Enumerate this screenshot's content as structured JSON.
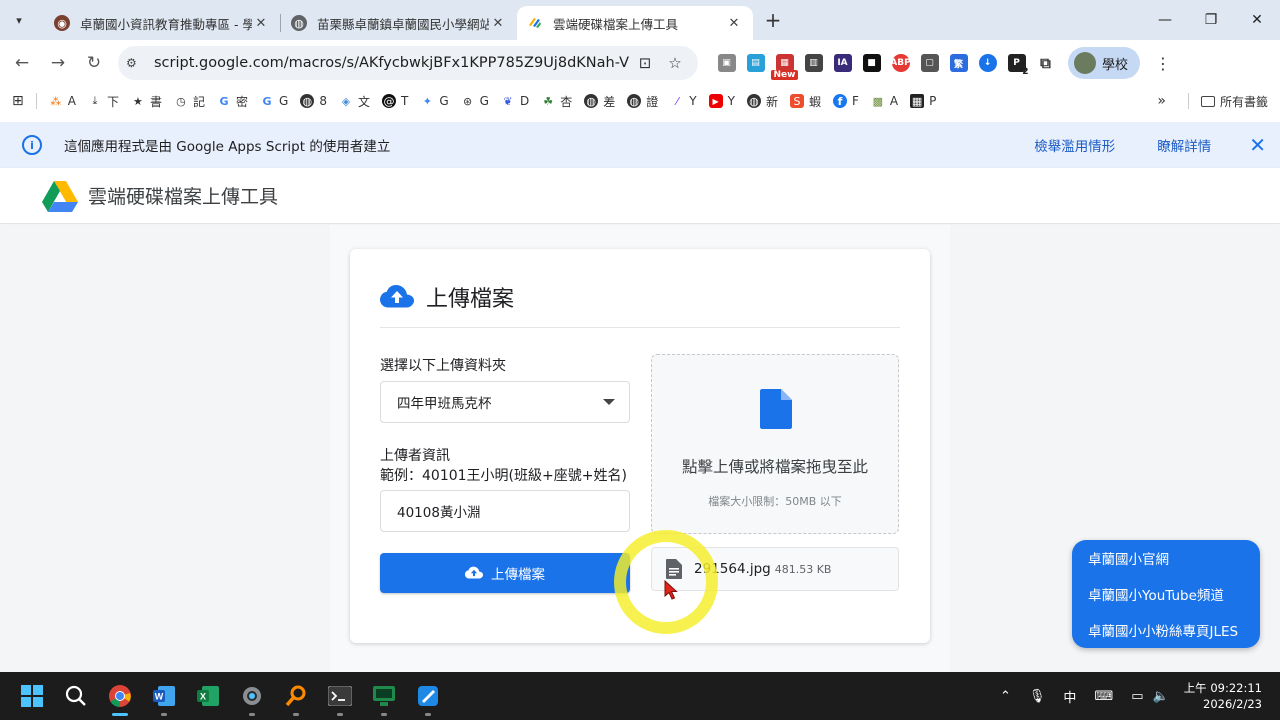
{
  "browser": {
    "tabs": [
      {
        "title": "卓蘭國小資訊教育推動專區 - 學",
        "active": false
      },
      {
        "title": "苗栗縣卓蘭鎮卓蘭國民小學網站",
        "active": false
      },
      {
        "title": "雲端硬碟檔案上傳工具",
        "active": true
      }
    ],
    "url": "script.google.com/macros/s/AKfycbwkjBFx1KPP785Z9Uj8dKNah-VE0...",
    "profile_label": "學校",
    "new_badge": "New",
    "ext_badge_count": "2"
  },
  "bookmarks": {
    "items": [
      "A",
      "下",
      "書",
      "記",
      "密",
      "G",
      "8",
      "文",
      "T",
      "G",
      "G",
      "D",
      "杏",
      "差",
      "證",
      "Y",
      "Y",
      "新",
      "蝦",
      "F",
      "A",
      "P"
    ],
    "all_bookmarks": "所有書籤"
  },
  "infobar": {
    "message": "這個應用程式是由 Google Apps Script 的使用者建立",
    "report": "檢舉濫用情形",
    "learn_more": "瞭解詳情"
  },
  "app": {
    "title": "雲端硬碟檔案上傳工具"
  },
  "card": {
    "title": "上傳檔案",
    "folder_label": "選擇以下上傳資料夾",
    "folder_value": "四年甲班馬克杯",
    "uploader_label": "上傳者資訊",
    "uploader_example": "範例：40101王小明(班級+座號+姓名)",
    "uploader_value": "40108黃小淵",
    "upload_button": "上傳檔案",
    "dropzone_text": "點擊上傳或將檔案拖曳至此",
    "dropzone_limit": "檔案大小限制：50MB 以下",
    "file_name": "291564.jpg",
    "file_size": "481.53 KB"
  },
  "float_menu": [
    "卓蘭國小官網",
    "卓蘭國小YouTube頻道",
    "卓蘭國小小粉絲專頁JLES"
  ],
  "taskbar": {
    "time_line1": "上午 09:22:11",
    "time_line2": "2026/2/23",
    "ime": "中"
  },
  "colors": {
    "accent": "#1a73e8",
    "infobar_bg": "#e8f0fe",
    "tabstrip_bg": "#dfe8f2",
    "highlight_ring": "#f5ee28"
  }
}
